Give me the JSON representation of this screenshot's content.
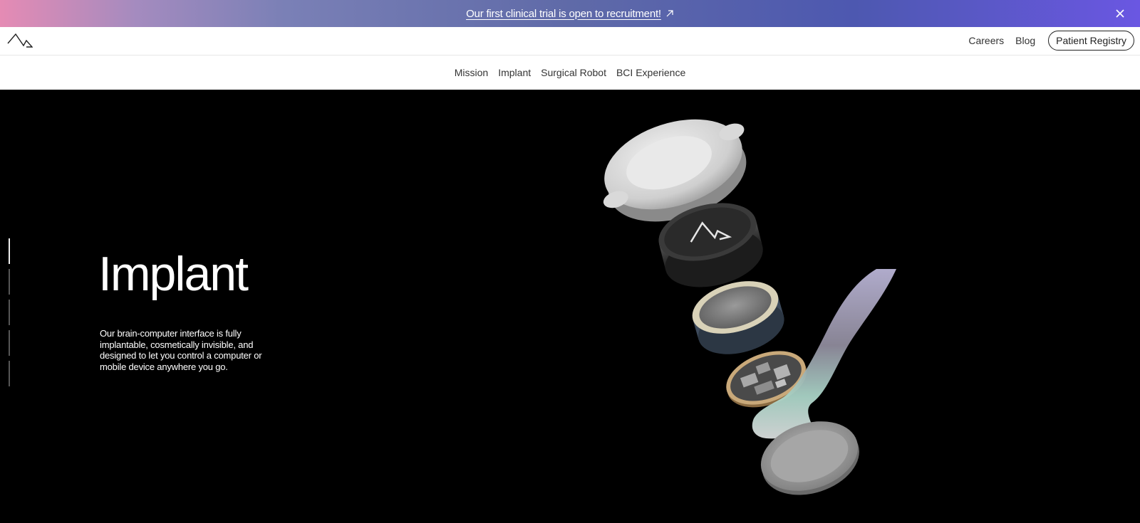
{
  "announcement": {
    "text": "Our first clinical trial is open to recruitment!",
    "link_icon": "arrow-up-right-icon",
    "close_icon": "close-icon"
  },
  "header": {
    "logo": "neuralink-logo",
    "links": [
      "Careers",
      "Blog"
    ],
    "registry_label": "Patient Registry"
  },
  "subnav": {
    "items": [
      "Mission",
      "Implant",
      "Surgical Robot",
      "BCI Experience"
    ]
  },
  "hero": {
    "title": "Implant",
    "description": "Our brain-computer interface is fully implantable, cosmetically invisible, and designed to let you control a computer or mobile device anywhere you go.",
    "progress_sections": 5,
    "active_section": 1
  },
  "colors": {
    "banner_start": "#e58bb4",
    "banner_end": "#6a57e2",
    "hero_bg": "#000000"
  }
}
